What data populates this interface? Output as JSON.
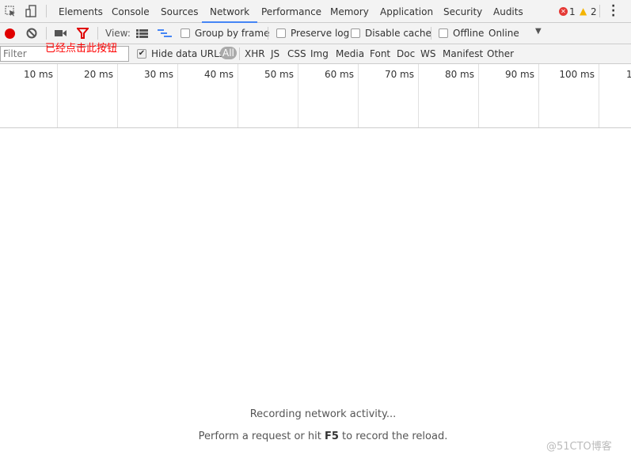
{
  "tabs": [
    "Elements",
    "Console",
    "Sources",
    "Network",
    "Performance",
    "Memory",
    "Application",
    "Security",
    "Audits"
  ],
  "active_tab": "Network",
  "errors": "1",
  "warnings": "2",
  "toolbar": {
    "view_label": "View:",
    "group_by_frame": "Group by frame",
    "preserve_log": "Preserve log",
    "disable_cache": "Disable cache",
    "offline": "Offline",
    "throttle": "Online",
    "annotation": "已经点击此按钮"
  },
  "filter": {
    "placeholder": "Filter",
    "hide_data_urls": "Hide data URLs",
    "types": [
      "All",
      "XHR",
      "JS",
      "CSS",
      "Img",
      "Media",
      "Font",
      "Doc",
      "WS",
      "Manifest",
      "Other"
    ]
  },
  "timeline": [
    "10 ms",
    "20 ms",
    "30 ms",
    "40 ms",
    "50 ms",
    "60 ms",
    "70 ms",
    "80 ms",
    "90 ms",
    "100 ms",
    "1"
  ],
  "empty": {
    "line1": "Recording network activity...",
    "line2_pre": "Perform a request or hit ",
    "line2_key": "F5",
    "line2_post": " to record the reload."
  },
  "watermark": "@51CTO博客",
  "colors": {
    "record": "#e00000",
    "accent": "#4585f5",
    "annotation": "#ff0000"
  }
}
